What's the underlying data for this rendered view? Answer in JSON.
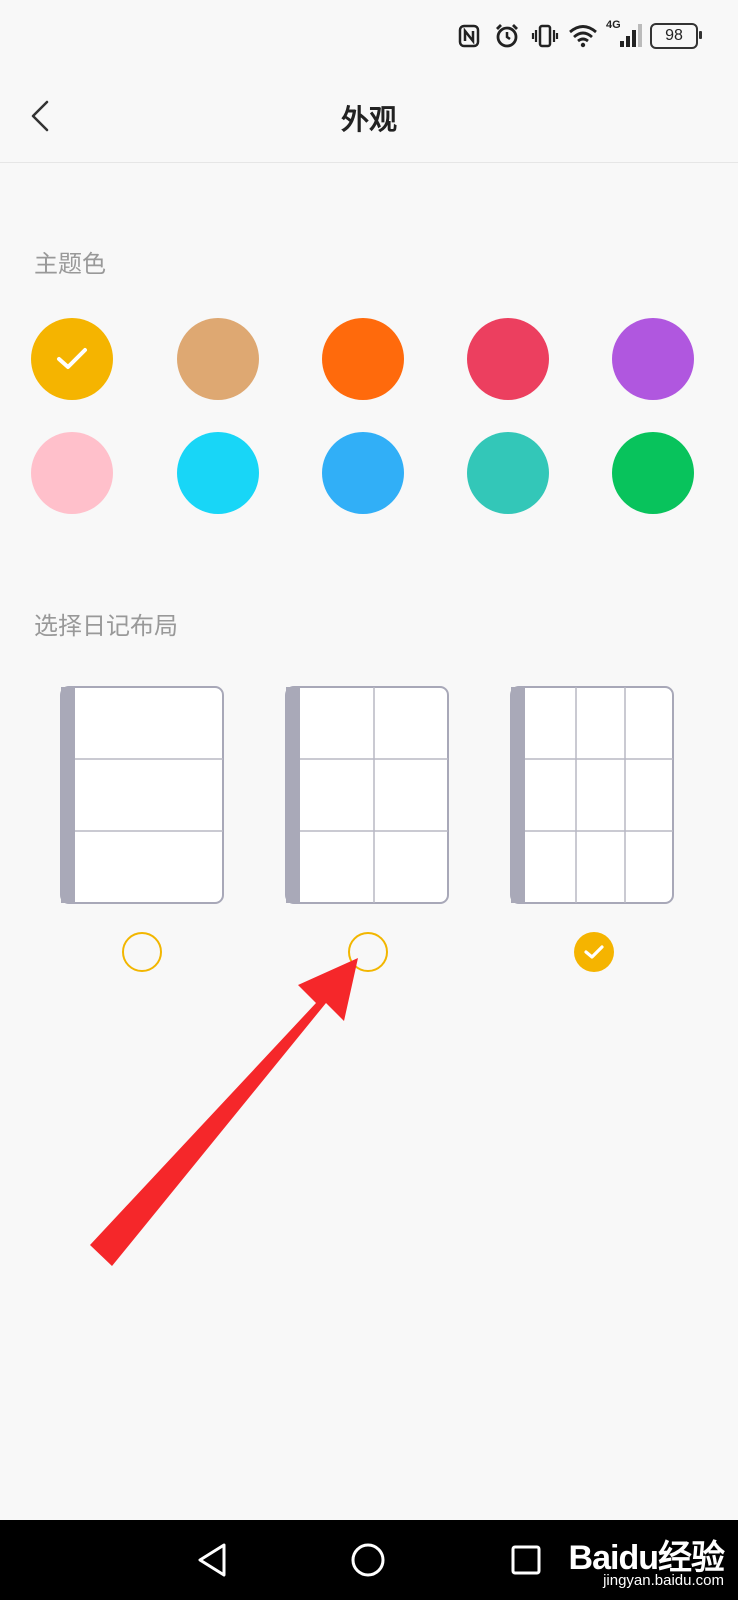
{
  "status_bar": {
    "network": "4G",
    "battery": "98",
    "icons": [
      "nfc-icon",
      "alarm-icon",
      "vibrate-icon",
      "wifi-icon",
      "signal-icon",
      "battery-icon"
    ]
  },
  "header": {
    "title": "外观",
    "back_icon": "chevron-left-icon"
  },
  "theme_section": {
    "label": "主题色",
    "selected_index": 0,
    "colors": [
      "#f5b400",
      "#dea872",
      "#ff6a0c",
      "#ec3f5f",
      "#b057df",
      "#ffc0cb",
      "#18d6f7",
      "#31aff7",
      "#33c7b8",
      "#08c35c"
    ]
  },
  "layout_section": {
    "label": "选择日记布局",
    "layouts": [
      {
        "columns": 1,
        "rows": 3,
        "selected": false
      },
      {
        "columns": 2,
        "rows": 3,
        "selected": false
      },
      {
        "columns": 3,
        "rows": 3,
        "selected": true
      }
    ]
  },
  "annotation": {
    "type": "arrow",
    "color": "#f5272a",
    "points_to": "layout-radio-2"
  },
  "nav_bar": {
    "buttons": [
      "back-triangle-icon",
      "home-circle-icon",
      "recents-square-icon"
    ]
  },
  "watermark": {
    "brand": "Baidu经验",
    "url": "jingyan.baidu.com"
  }
}
